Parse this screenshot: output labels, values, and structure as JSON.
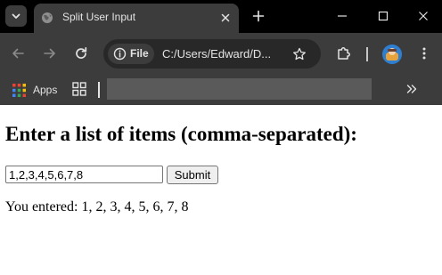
{
  "browser": {
    "tab_title": "Split User Input",
    "site_chip_label": "File",
    "url": "C:/Users/Edward/D...",
    "bookmarks": {
      "apps_label": "Apps"
    },
    "icons": {
      "tab_search": "chevron-down-icon",
      "favicon": "globe-icon",
      "tab_close": "close-icon",
      "new_tab": "plus-icon",
      "minimize": "minimize-icon",
      "maximize": "maximize-icon",
      "close": "close-icon",
      "back": "arrow-left-icon",
      "forward": "arrow-right-icon",
      "reload": "reload-icon",
      "info": "info-icon",
      "bookmark": "star-icon",
      "extensions": "puzzle-icon",
      "menu": "kebab-menu-icon",
      "apps": "apps-grid-icon",
      "tab_groups": "tab-groups-icon",
      "bookmarks_overflow": "double-chevron-right-icon"
    },
    "colors": {
      "titlebar": "#000000",
      "toolbar": "#3c3c3c",
      "omnibox": "#282828",
      "text": "#e3e3e3"
    }
  },
  "page": {
    "heading": "Enter a list of items (comma-separated):",
    "input_value": "1,2,3,4,5,6,7,8",
    "submit_label": "Submit",
    "result_text": "You entered: 1, 2, 3, 4, 5, 6, 7, 8"
  }
}
